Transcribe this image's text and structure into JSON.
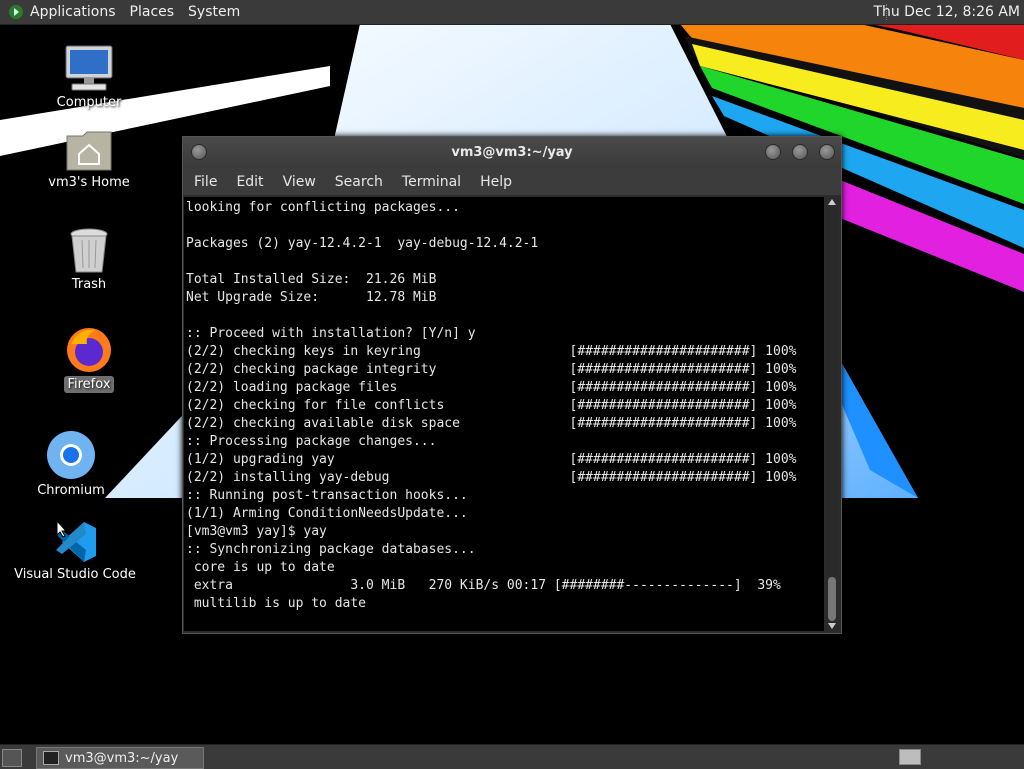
{
  "top_panel": {
    "menus": [
      "Applications",
      "Places",
      "System"
    ],
    "clock": "Thu Dec 12,  8:26 AM"
  },
  "desktop": {
    "icons": [
      {
        "label": "Computer",
        "icon": "computer-icon"
      },
      {
        "label": "vm3's Home",
        "icon": "home-folder-icon"
      },
      {
        "label": "Trash",
        "icon": "trash-icon"
      },
      {
        "label": "Firefox",
        "icon": "firefox-icon"
      },
      {
        "label": "Chromium",
        "icon": "chromium-icon"
      },
      {
        "label": "Visual Studio Code",
        "icon": "vscode-icon"
      }
    ]
  },
  "terminal": {
    "title": "vm3@vm3:~/yay",
    "menu": [
      "File",
      "Edit",
      "View",
      "Search",
      "Terminal",
      "Help"
    ],
    "lines": [
      "looking for conflicting packages...",
      "",
      "Packages (2) yay-12.4.2-1  yay-debug-12.4.2-1",
      "",
      "Total Installed Size:  21.26 MiB",
      "Net Upgrade Size:      12.78 MiB",
      "",
      ":: Proceed with installation? [Y/n] y",
      "(2/2) checking keys in keyring                   [######################] 100%",
      "(2/2) checking package integrity                 [######################] 100%",
      "(2/2) loading package files                      [######################] 100%",
      "(2/2) checking for file conflicts                [######################] 100%",
      "(2/2) checking available disk space              [######################] 100%",
      ":: Processing package changes...",
      "(1/2) upgrading yay                              [######################] 100%",
      "(2/2) installing yay-debug                       [######################] 100%",
      ":: Running post-transaction hooks...",
      "(1/1) Arming ConditionNeedsUpdate...",
      "[vm3@vm3 yay]$ yay",
      ":: Synchronizing package databases...",
      " core is up to date",
      " extra               3.0 MiB   270 KiB/s 00:17 [########--------------]  39%",
      " multilib is up to date"
    ]
  },
  "bottom_panel": {
    "task_label": "vm3@vm3:~/yay"
  },
  "colors": {
    "panel_bg": "#3a3a3a",
    "terminal_bg": "#000000",
    "terminal_fg": "#e6e6e6",
    "rainbow": [
      "#e11d1d",
      "#f5830c",
      "#f6ec1e",
      "#21d62a",
      "#1ea7f0",
      "#e120e0"
    ]
  }
}
